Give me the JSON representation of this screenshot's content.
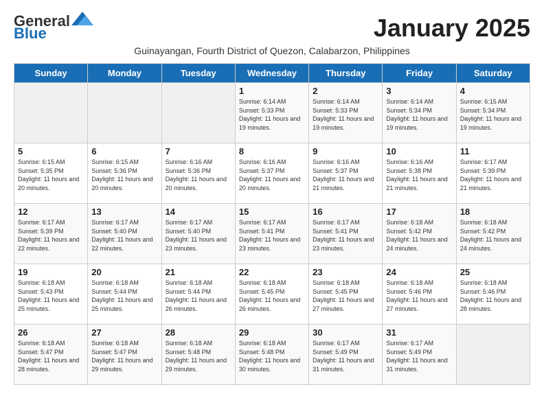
{
  "logo": {
    "general": "General",
    "blue": "Blue"
  },
  "title": "January 2025",
  "subtitle": "Guinayangan, Fourth District of Quezon, Calabarzon, Philippines",
  "weekdays": [
    "Sunday",
    "Monday",
    "Tuesday",
    "Wednesday",
    "Thursday",
    "Friday",
    "Saturday"
  ],
  "weeks": [
    [
      {
        "day": "",
        "info": ""
      },
      {
        "day": "",
        "info": ""
      },
      {
        "day": "",
        "info": ""
      },
      {
        "day": "1",
        "info": "Sunrise: 6:14 AM\nSunset: 5:33 PM\nDaylight: 11 hours and 19 minutes."
      },
      {
        "day": "2",
        "info": "Sunrise: 6:14 AM\nSunset: 5:33 PM\nDaylight: 11 hours and 19 minutes."
      },
      {
        "day": "3",
        "info": "Sunrise: 6:14 AM\nSunset: 5:34 PM\nDaylight: 11 hours and 19 minutes."
      },
      {
        "day": "4",
        "info": "Sunrise: 6:15 AM\nSunset: 5:34 PM\nDaylight: 11 hours and 19 minutes."
      }
    ],
    [
      {
        "day": "5",
        "info": "Sunrise: 6:15 AM\nSunset: 5:35 PM\nDaylight: 11 hours and 20 minutes."
      },
      {
        "day": "6",
        "info": "Sunrise: 6:15 AM\nSunset: 5:36 PM\nDaylight: 11 hours and 20 minutes."
      },
      {
        "day": "7",
        "info": "Sunrise: 6:16 AM\nSunset: 5:36 PM\nDaylight: 11 hours and 20 minutes."
      },
      {
        "day": "8",
        "info": "Sunrise: 6:16 AM\nSunset: 5:37 PM\nDaylight: 11 hours and 20 minutes."
      },
      {
        "day": "9",
        "info": "Sunrise: 6:16 AM\nSunset: 5:37 PM\nDaylight: 11 hours and 21 minutes."
      },
      {
        "day": "10",
        "info": "Sunrise: 6:16 AM\nSunset: 5:38 PM\nDaylight: 11 hours and 21 minutes."
      },
      {
        "day": "11",
        "info": "Sunrise: 6:17 AM\nSunset: 5:39 PM\nDaylight: 11 hours and 21 minutes."
      }
    ],
    [
      {
        "day": "12",
        "info": "Sunrise: 6:17 AM\nSunset: 5:39 PM\nDaylight: 11 hours and 22 minutes."
      },
      {
        "day": "13",
        "info": "Sunrise: 6:17 AM\nSunset: 5:40 PM\nDaylight: 11 hours and 22 minutes."
      },
      {
        "day": "14",
        "info": "Sunrise: 6:17 AM\nSunset: 5:40 PM\nDaylight: 11 hours and 23 minutes."
      },
      {
        "day": "15",
        "info": "Sunrise: 6:17 AM\nSunset: 5:41 PM\nDaylight: 11 hours and 23 minutes."
      },
      {
        "day": "16",
        "info": "Sunrise: 6:17 AM\nSunset: 5:41 PM\nDaylight: 11 hours and 23 minutes."
      },
      {
        "day": "17",
        "info": "Sunrise: 6:18 AM\nSunset: 5:42 PM\nDaylight: 11 hours and 24 minutes."
      },
      {
        "day": "18",
        "info": "Sunrise: 6:18 AM\nSunset: 5:42 PM\nDaylight: 11 hours and 24 minutes."
      }
    ],
    [
      {
        "day": "19",
        "info": "Sunrise: 6:18 AM\nSunset: 5:43 PM\nDaylight: 11 hours and 25 minutes."
      },
      {
        "day": "20",
        "info": "Sunrise: 6:18 AM\nSunset: 5:44 PM\nDaylight: 11 hours and 25 minutes."
      },
      {
        "day": "21",
        "info": "Sunrise: 6:18 AM\nSunset: 5:44 PM\nDaylight: 11 hours and 26 minutes."
      },
      {
        "day": "22",
        "info": "Sunrise: 6:18 AM\nSunset: 5:45 PM\nDaylight: 11 hours and 26 minutes."
      },
      {
        "day": "23",
        "info": "Sunrise: 6:18 AM\nSunset: 5:45 PM\nDaylight: 11 hours and 27 minutes."
      },
      {
        "day": "24",
        "info": "Sunrise: 6:18 AM\nSunset: 5:46 PM\nDaylight: 11 hours and 27 minutes."
      },
      {
        "day": "25",
        "info": "Sunrise: 6:18 AM\nSunset: 5:46 PM\nDaylight: 11 hours and 28 minutes."
      }
    ],
    [
      {
        "day": "26",
        "info": "Sunrise: 6:18 AM\nSunset: 5:47 PM\nDaylight: 11 hours and 28 minutes."
      },
      {
        "day": "27",
        "info": "Sunrise: 6:18 AM\nSunset: 5:47 PM\nDaylight: 11 hours and 29 minutes."
      },
      {
        "day": "28",
        "info": "Sunrise: 6:18 AM\nSunset: 5:48 PM\nDaylight: 11 hours and 29 minutes."
      },
      {
        "day": "29",
        "info": "Sunrise: 6:18 AM\nSunset: 5:48 PM\nDaylight: 11 hours and 30 minutes."
      },
      {
        "day": "30",
        "info": "Sunrise: 6:17 AM\nSunset: 5:49 PM\nDaylight: 11 hours and 31 minutes."
      },
      {
        "day": "31",
        "info": "Sunrise: 6:17 AM\nSunset: 5:49 PM\nDaylight: 11 hours and 31 minutes."
      },
      {
        "day": "",
        "info": ""
      }
    ]
  ]
}
